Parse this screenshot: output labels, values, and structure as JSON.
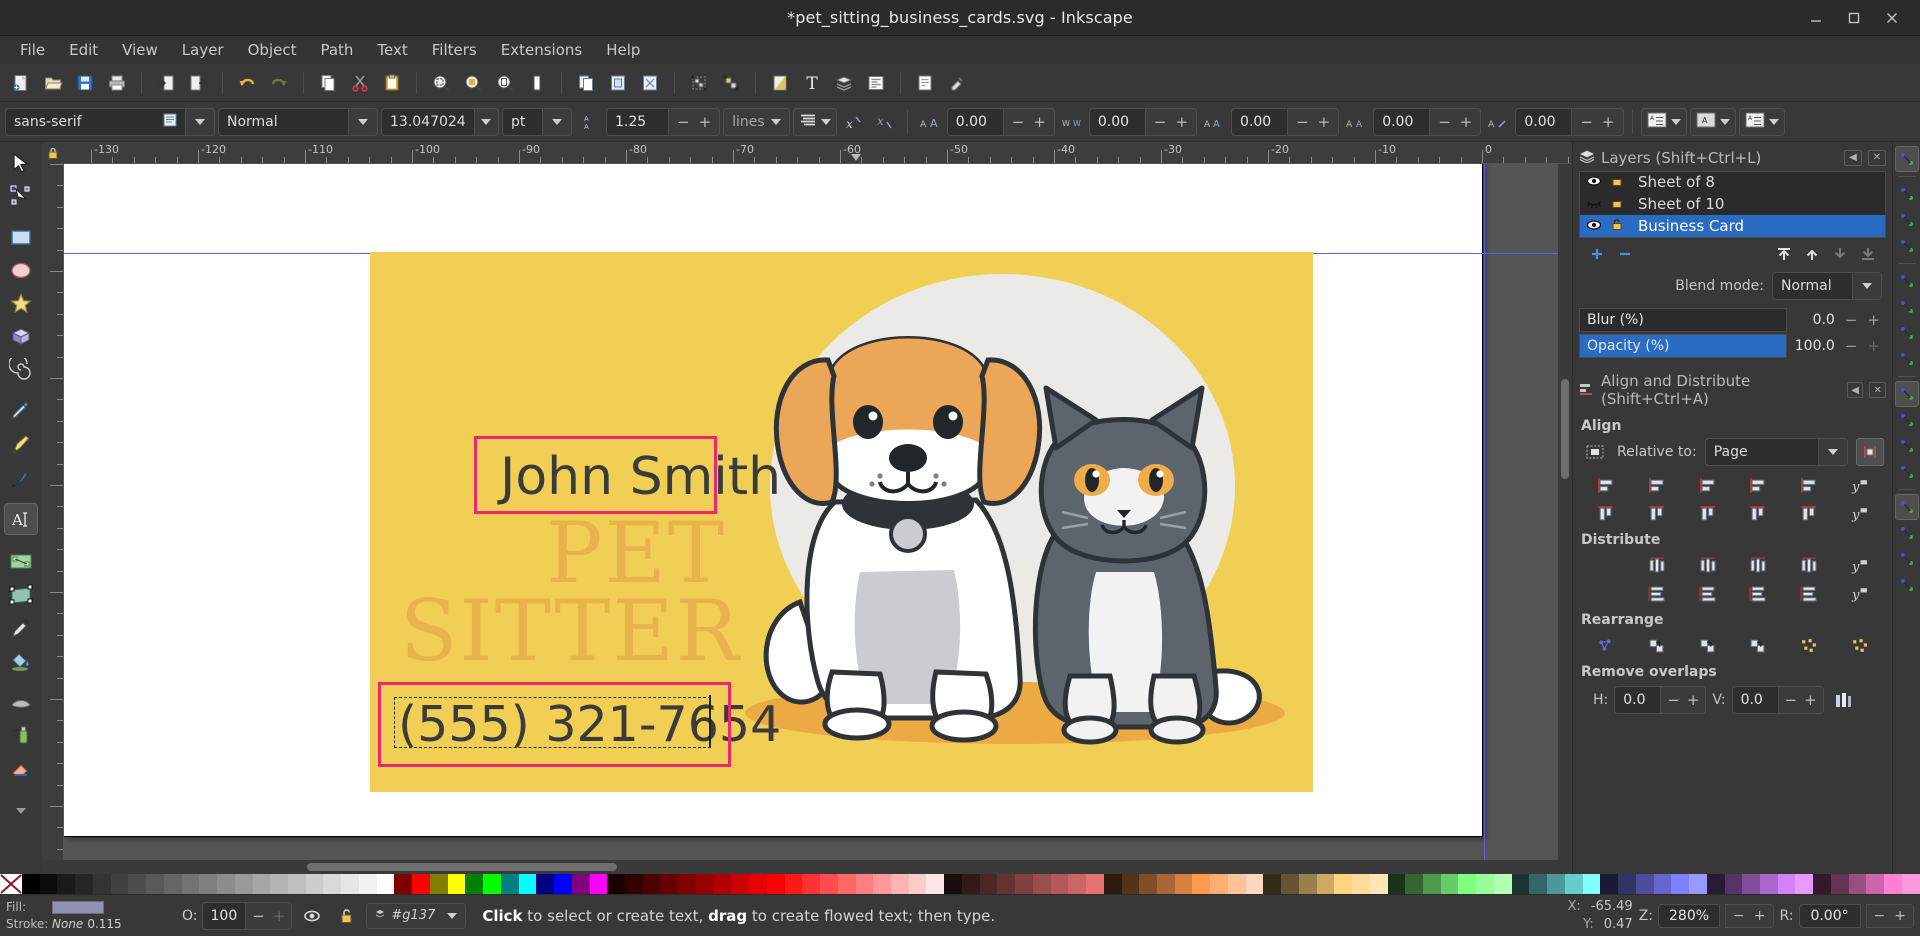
{
  "window": {
    "title": "*pet_sitting_business_cards.svg - Inkscape",
    "minimize": "minimize-icon",
    "maximize": "maximize-icon",
    "close": "close-icon"
  },
  "menu": {
    "items": [
      "File",
      "Edit",
      "View",
      "Layer",
      "Object",
      "Path",
      "Text",
      "Filters",
      "Extensions",
      "Help"
    ]
  },
  "commandbar": {
    "buttons": [
      "new-document-icon",
      "open-document-icon",
      "save-document-icon",
      "print-icon",
      "import-icon",
      "export-icon",
      "undo-icon",
      "redo-icon",
      "copy-icon",
      "cut-icon",
      "paste-icon",
      "zoom-selection-icon",
      "zoom-drawing-icon",
      "zoom-page-icon",
      "zoom-page-width-icon",
      "duplicate-icon",
      "clone-icon",
      "unlink-clone-icon",
      "group-icon",
      "ungroup-icon",
      "fill-stroke-dialog-icon",
      "text-properties-icon",
      "layers-dialog-icon",
      "xml-editor-icon",
      "document-properties-icon",
      "preferences-icon"
    ]
  },
  "text_toolbar": {
    "font_family": "sans-serif",
    "font_family_icon": "font-list-icon",
    "font_style": "Normal",
    "font_size": "13.047024",
    "font_size_unit": "pt",
    "line_spacing_icon": "line-height-icon",
    "line_spacing": "1.25",
    "line_spacing_unit": "lines",
    "alignment_icon": "align-text-icon",
    "superscript_icon": "superscript-icon",
    "subscript_icon": "subscript-icon",
    "letter_spacing_icon": "letter-spacing-icon",
    "letter_spacing": "0.00",
    "word_spacing_icon": "word-spacing-icon",
    "word_spacing": "0.00",
    "horizontal_kerning_icon": "horizontal-kerning-icon",
    "horizontal_kerning": "0.00",
    "vertical_kerning_icon": "vertical-kerning-icon",
    "vertical_kerning": "0.00",
    "rotation_icon": "character-rotation-icon",
    "rotation": "0.00",
    "writing_mode_icon": "writing-mode-icon",
    "orientation_icon": "text-orientation-icon",
    "direction_icon": "text-direction-icon"
  },
  "toolbox": {
    "tools": [
      {
        "name": "selector-tool",
        "icon": "arrow-cursor-icon",
        "active": false
      },
      {
        "name": "node-tool",
        "icon": "node-editor-icon",
        "active": false
      },
      {
        "name": "rectangle-tool",
        "icon": "rectangle-icon",
        "active": false
      },
      {
        "name": "ellipse-tool",
        "icon": "ellipse-icon",
        "active": false
      },
      {
        "name": "star-tool",
        "icon": "star-icon",
        "active": false
      },
      {
        "name": "3dbox-tool",
        "icon": "cube-icon",
        "active": false
      },
      {
        "name": "spiral-tool",
        "icon": "spiral-icon",
        "active": false
      },
      {
        "name": "pencil-tool",
        "icon": "pencil-icon",
        "active": false
      },
      {
        "name": "bezier-tool",
        "icon": "bezier-pen-icon",
        "active": false
      },
      {
        "name": "calligraphy-tool",
        "icon": "calligraphy-pen-icon",
        "active": false
      },
      {
        "name": "text-tool",
        "icon": "text-a-icon",
        "active": true
      },
      {
        "name": "gradient-tool",
        "icon": "gradient-icon",
        "active": false
      },
      {
        "name": "mesh-tool",
        "icon": "mesh-gradient-icon",
        "active": false
      },
      {
        "name": "dropper-tool",
        "icon": "eyedropper-icon",
        "active": false
      },
      {
        "name": "paint-bucket-tool",
        "icon": "paint-bucket-icon",
        "active": false
      },
      {
        "name": "tweak-tool",
        "icon": "tweak-icon",
        "active": false
      },
      {
        "name": "spray-tool",
        "icon": "spray-can-icon",
        "active": false
      },
      {
        "name": "eraser-tool",
        "icon": "eraser-icon",
        "active": false
      },
      {
        "name": "more-tools",
        "icon": "chevron-down-icon",
        "active": false
      }
    ]
  },
  "rulers": {
    "horizontal_labels": [
      "-130",
      "-120",
      "-110",
      "-100",
      "-90",
      "-80",
      "-70",
      "-60",
      "-50",
      "-40",
      "-30",
      "-20",
      "-10",
      "0"
    ],
    "lock_icon": "ruler-lock-icon"
  },
  "canvas": {
    "card": {
      "name_text": "John Smith",
      "tagline_line1": "PET",
      "tagline_line2": "SITTER",
      "phone_text": "(555) 321-7654",
      "bg_color": "#f1cf55",
      "tagline_color": "#e8b24d",
      "text_color": "#3b3b3b",
      "selection_color": "#f0246f"
    }
  },
  "layers_panel": {
    "title": "Layers (Shift+Ctrl+L)",
    "panel_icon": "layers-stack-icon",
    "collapse_icon": "collapse-icon",
    "close_icon": "close-panel-icon",
    "rows": [
      {
        "label": "Sheet of 8",
        "visible": true,
        "locked": false,
        "selected": false
      },
      {
        "label": "Sheet of 10",
        "visible": false,
        "locked": false,
        "selected": false
      },
      {
        "label": "Business Card",
        "visible": true,
        "locked": false,
        "selected": true
      }
    ],
    "add_label": "+",
    "remove_label": "−",
    "raise_top_icon": "raise-to-top-icon",
    "raise_icon": "raise-icon",
    "lower_icon": "lower-icon",
    "lower_bottom_icon": "lower-to-bottom-icon",
    "blend_label": "Blend mode:",
    "blend_value": "Normal",
    "blur_label": "Blur (%)",
    "blur_value": "0.0",
    "opacity_label": "Opacity (%)",
    "opacity_value": "100.0",
    "opacity_percent": 100
  },
  "align_panel": {
    "title": "Align and Distribute (Shift+Ctrl+A)",
    "panel_icon": "align-panel-icon",
    "collapse_icon": "collapse-icon",
    "close_icon": "close-panel-icon",
    "align_label": "Align",
    "treat_selection_icon": "treat-selection-as-group-icon",
    "relative_label": "Relative to:",
    "relative_value": "Page",
    "move_as_group_icon": "move-as-group-icon",
    "distribute_label": "Distribute",
    "rearrange_label": "Rearrange",
    "remove_overlaps_label": "Remove overlaps",
    "h_label": "H:",
    "h_value": "0.0",
    "v_label": "V:",
    "v_value": "0.0",
    "remove_overlaps_icon": "remove-overlaps-icon"
  },
  "snapbar": {
    "buttons": [
      "enable-snapping-icon",
      "snap-bounding-box-icon",
      "snap-bbox-edge-icon",
      "snap-bbox-corner-icon",
      "snap-nodes-icon",
      "snap-paths-icon",
      "snap-path-intersection-icon",
      "snap-cusp-nodes-icon",
      "snap-smooth-nodes-icon",
      "snap-midpoints-icon",
      "snap-object-centers-icon",
      "snap-rotation-centers-icon",
      "snap-text-baseline-icon",
      "snap-page-border-icon",
      "snap-grids-icon",
      "snap-guides-icon"
    ]
  },
  "statusbar": {
    "fill_label": "Fill:",
    "fill_value": "",
    "stroke_label": "Stroke:",
    "stroke_value": "None",
    "stroke_width": "0.115",
    "opacity_label": "O:",
    "opacity_value": "100",
    "layer_visibility_icon": "eye-icon",
    "layer_lock_icon": "unlock-icon",
    "layer_indicator_icon": "layer-icon",
    "layer_name": "#g137",
    "message_bold_1": "Click",
    "message_mid_1": " to select or create text, ",
    "message_bold_2": "drag",
    "message_mid_2": " to create flowed text; then type.",
    "x_label": "X:",
    "x_value": "-65.49",
    "y_label": "Y:",
    "y_value": "0.47",
    "z_label": "Z:",
    "zoom_value": "280%",
    "r_label": "R:",
    "rotation_value": "0.00°"
  },
  "palette": {
    "none_swatch": "none-color-icon",
    "colors": [
      "#000000",
      "#0d0d0d",
      "#1a1a1a",
      "#262626",
      "#333333",
      "#404040",
      "#4d4d4d",
      "#595959",
      "#666666",
      "#737373",
      "#808080",
      "#8c8c8c",
      "#999999",
      "#a6a6a6",
      "#b3b3b3",
      "#bfbfbf",
      "#cccccc",
      "#d9d9d9",
      "#e6e6e6",
      "#f2f2f2",
      "#ffffff",
      "#800000",
      "#ff0000",
      "#808000",
      "#ffff00",
      "#008000",
      "#00ff00",
      "#008080",
      "#00ffff",
      "#000080",
      "#0000ff",
      "#800080",
      "#ff00ff",
      "#1a0000",
      "#330000",
      "#4d0000",
      "#660000",
      "#800000",
      "#990000",
      "#b30000",
      "#cc0000",
      "#e60000",
      "#ff0000",
      "#ff1a1a",
      "#ff3333",
      "#ff4d4d",
      "#ff6666",
      "#ff8080",
      "#ff9999",
      "#ffb3b3",
      "#ffcccc",
      "#ffe6e6",
      "#1a0d0d",
      "#331a1a",
      "#4d2626",
      "#663333",
      "#804040",
      "#994d4d",
      "#b35959",
      "#cc6666",
      "#e67373",
      "#2b1a0d",
      "#55331a",
      "#804d26",
      "#aa6633",
      "#d48040",
      "#ff994d",
      "#ffad73",
      "#ffc299",
      "#ffd6bf",
      "#332b1a",
      "#665533",
      "#99804d",
      "#ccaa66",
      "#ffd480",
      "#ffdd99",
      "#ffe6b3",
      "#1a331a",
      "#336633",
      "#4d994d",
      "#66cc66",
      "#80ff80",
      "#99ff99",
      "#b3ffb3",
      "#1a3333",
      "#336666",
      "#4d9999",
      "#66cccc",
      "#80ffff",
      "#1a1a33",
      "#333366",
      "#4d4d99",
      "#6666cc",
      "#8080ff",
      "#9999ff",
      "#2b1a33",
      "#553366",
      "#804d99",
      "#aa66cc",
      "#d480ff",
      "#e699ff",
      "#331a2b",
      "#663355",
      "#994d80",
      "#cc66aa",
      "#ff80d4",
      "#ff99dd"
    ]
  }
}
